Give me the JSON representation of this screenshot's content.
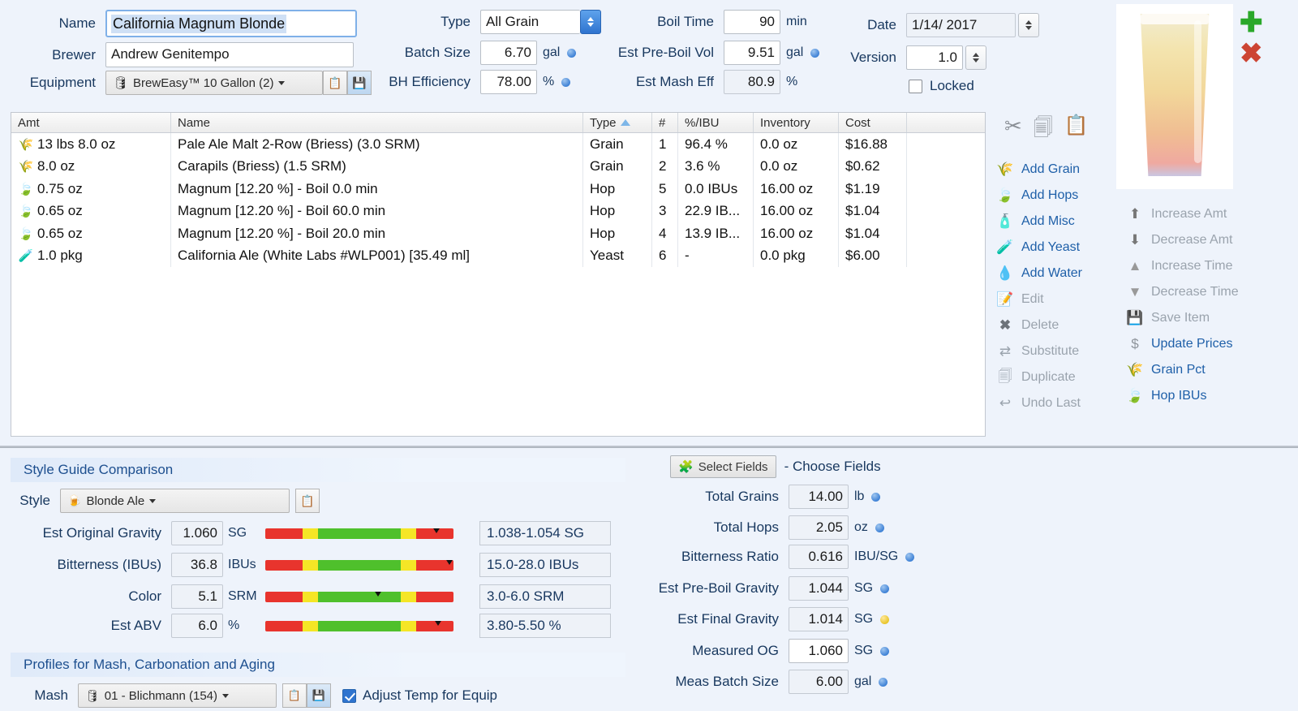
{
  "header": {
    "name_label": "Name",
    "name_value": "California Magnum Blonde",
    "brewer_label": "Brewer",
    "brewer_value": "Andrew Genitempo",
    "equipment_label": "Equipment",
    "equipment_value": "BrewEasy™ 10 Gallon (2)",
    "type_label": "Type",
    "type_value": "All Grain",
    "batch_size_label": "Batch Size",
    "batch_size_value": "6.70",
    "batch_size_unit": "gal",
    "bh_efficiency_label": "BH Efficiency",
    "bh_efficiency_value": "78.00",
    "bh_efficiency_unit": "%",
    "boil_time_label": "Boil Time",
    "boil_time_value": "90",
    "boil_time_unit": "min",
    "pre_boil_vol_label": "Est Pre-Boil Vol",
    "pre_boil_vol_value": "9.51",
    "pre_boil_vol_unit": "gal",
    "mash_eff_label": "Est Mash Eff",
    "mash_eff_value": "80.9",
    "mash_eff_unit": "%",
    "date_label": "Date",
    "date_value": "1/14/ 2017",
    "version_label": "Version",
    "version_value": "1.0",
    "locked_label": "Locked",
    "locked_checked": false
  },
  "table": {
    "columns": [
      "Amt",
      "Name",
      "Type",
      "#",
      "%/IBU",
      "Inventory",
      "Cost"
    ],
    "sort_column": "Type",
    "rows": [
      {
        "icon": "grain-icon",
        "amt": "13 lbs 8.0 oz",
        "name": "Pale Ale Malt 2-Row (Briess) (3.0 SRM)",
        "type": "Grain",
        "num": "1",
        "ibu": "96.4 %",
        "inventory": "0.0 oz",
        "cost": "$16.88"
      },
      {
        "icon": "grain-icon",
        "amt": "8.0 oz",
        "name": "Carapils (Briess) (1.5 SRM)",
        "type": "Grain",
        "num": "2",
        "ibu": "3.6 %",
        "inventory": "0.0 oz",
        "cost": "$0.62"
      },
      {
        "icon": "hop-icon",
        "amt": "0.75 oz",
        "name": "Magnum [12.20 %] - Boil 0.0 min",
        "type": "Hop",
        "num": "5",
        "ibu": "0.0 IBUs",
        "inventory": "16.00 oz",
        "cost": "$1.19"
      },
      {
        "icon": "hop-icon",
        "amt": "0.65 oz",
        "name": "Magnum [12.20 %] - Boil 60.0 min",
        "type": "Hop",
        "num": "3",
        "ibu": "22.9 IB...",
        "inventory": "16.00 oz",
        "cost": "$1.04"
      },
      {
        "icon": "hop-icon",
        "amt": "0.65 oz",
        "name": "Magnum [12.20 %] - Boil 20.0 min",
        "type": "Hop",
        "num": "4",
        "ibu": "13.9 IB...",
        "inventory": "16.00 oz",
        "cost": "$1.04"
      },
      {
        "icon": "yeast-icon",
        "amt": "1.0 pkg",
        "name": "California Ale (White Labs #WLP001) [35.49 ml]",
        "type": "Yeast",
        "num": "6",
        "ibu": "-",
        "inventory": "0.0 pkg",
        "cost": "$6.00"
      }
    ]
  },
  "sidebar": {
    "clipboard_icons": [
      "cut-icon",
      "copy-icon",
      "paste-icon"
    ],
    "actions": [
      {
        "label": "Add Grain",
        "icon": "grain-icon",
        "enabled": true
      },
      {
        "label": "Add Hops",
        "icon": "hop-icon",
        "enabled": true
      },
      {
        "label": "Add Misc",
        "icon": "misc-icon",
        "enabled": true
      },
      {
        "label": "Add Yeast",
        "icon": "yeast-icon",
        "enabled": true
      },
      {
        "label": "Add Water",
        "icon": "water-drop-icon",
        "enabled": true
      },
      {
        "label": "Edit",
        "icon": "edit-icon",
        "enabled": false
      },
      {
        "label": "Delete",
        "icon": "delete-x-icon",
        "enabled": false
      },
      {
        "label": "Substitute",
        "icon": "substitute-icon",
        "enabled": false
      },
      {
        "label": "Duplicate",
        "icon": "duplicate-icon",
        "enabled": false
      },
      {
        "label": "Undo Last",
        "icon": "undo-icon",
        "enabled": false
      }
    ],
    "actions2": [
      {
        "label": "Increase Amt",
        "icon": "arrow-up-icon",
        "enabled": false
      },
      {
        "label": "Decrease Amt",
        "icon": "arrow-down-icon",
        "enabled": false
      },
      {
        "label": "Increase Time",
        "icon": "triangle-up-icon",
        "enabled": false
      },
      {
        "label": "Decrease Time",
        "icon": "triangle-down-icon",
        "enabled": false
      },
      {
        "label": "Save Item",
        "icon": "save-disk-icon",
        "enabled": false
      },
      {
        "label": "Update Prices",
        "icon": "dollar-icon",
        "enabled": true
      },
      {
        "label": "Grain Pct",
        "icon": "grain-icon",
        "enabled": true
      },
      {
        "label": "Hop IBUs",
        "icon": "hop-icon",
        "enabled": true
      }
    ],
    "add_icon": "plus-icon",
    "remove_icon": "close-x-icon"
  },
  "style_panel": {
    "section_title": "Style Guide Comparison",
    "style_label": "Style",
    "style_value": "Blonde Ale",
    "rows": [
      {
        "label": "Est Original Gravity",
        "value": "1.060",
        "unit": "SG",
        "range": "1.038-1.054 SG",
        "marker_pct": 91
      },
      {
        "label": "Bitterness (IBUs)",
        "value": "36.8",
        "unit": "IBUs",
        "range": "15.0-28.0 IBUs",
        "marker_pct": 98
      },
      {
        "label": "Color",
        "value": "5.1",
        "unit": "SRM",
        "range": "3.0-6.0 SRM",
        "marker_pct": 60
      },
      {
        "label": "Est ABV",
        "value": "6.0",
        "unit": "%",
        "range": "3.80-5.50 %",
        "marker_pct": 92
      }
    ]
  },
  "profiles_panel": {
    "section_title": "Profiles for Mash, Carbonation and Aging",
    "mash_label": "Mash",
    "mash_value": "01 - Blichmann (154)",
    "adjust_temp_label": "Adjust Temp for Equip",
    "adjust_temp_checked": true
  },
  "stats_panel": {
    "select_fields_label": "Select Fields",
    "choose_fields_label": "- Choose Fields",
    "rows": [
      {
        "label": "Total Grains",
        "value": "14.00",
        "unit": "lb",
        "dot": "blue",
        "editable": false
      },
      {
        "label": "Total Hops",
        "value": "2.05",
        "unit": "oz",
        "dot": "blue",
        "editable": false
      },
      {
        "label": "Bitterness Ratio",
        "value": "0.616",
        "unit": "IBU/SG",
        "dot": "blue",
        "editable": false
      },
      {
        "label": "Est Pre-Boil Gravity",
        "value": "1.044",
        "unit": "SG",
        "dot": "blue",
        "editable": false
      },
      {
        "label": "Est Final Gravity",
        "value": "1.014",
        "unit": "SG",
        "dot": "yellow",
        "editable": false
      },
      {
        "label": "Measured OG",
        "value": "1.060",
        "unit": "SG",
        "dot": "blue",
        "editable": true
      },
      {
        "label": "Meas Batch Size",
        "value": "6.00",
        "unit": "gal",
        "dot": "blue",
        "editable": true
      }
    ]
  },
  "colors": {
    "accent": "#1e5fa8",
    "bar_red": "#e8342d",
    "bar_yellow": "#f5e626",
    "bar_green": "#4fc02c",
    "plus_green": "#2aa82a",
    "x_red": "#cc4433"
  }
}
